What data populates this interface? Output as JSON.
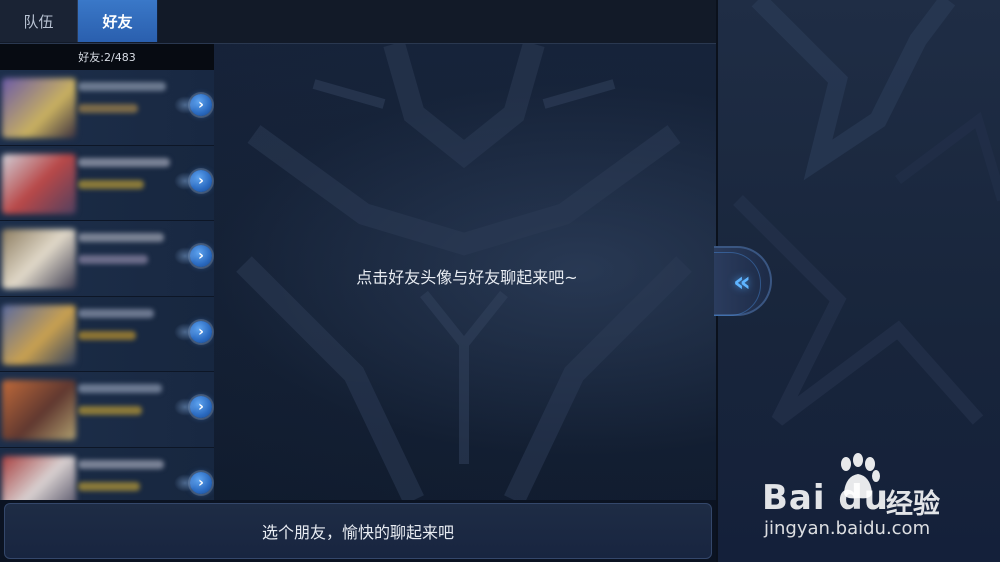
{
  "tabs": {
    "team_label": "队伍",
    "friends_label": "好友"
  },
  "friends_list": {
    "count_label": "好友:2/483",
    "rows": [
      {
        "avatar_color": "#6b5aa8",
        "chevron": "›"
      },
      {
        "avatar_color": "#b84848",
        "chevron": "›"
      },
      {
        "avatar_color": "#8c7c60",
        "chevron": "›"
      },
      {
        "avatar_color": "#5a6aa0",
        "chevron": "›"
      },
      {
        "avatar_color": "#c06a3a",
        "chevron": "›"
      },
      {
        "avatar_color": "#a84040",
        "chevron": "›"
      }
    ]
  },
  "chat": {
    "hint": "点击好友头像与好友聊起来吧~"
  },
  "input": {
    "placeholder": "选个朋友，愉快的聊起来吧"
  },
  "collapse_handle": {
    "glyph": "«"
  },
  "watermark": {
    "logo": "Bai du",
    "logo_cn": "经验",
    "url": "jingyan.baidu.com"
  },
  "colors": {
    "tab_active": "#3a78c8",
    "accent_blue": "#5fb4ff",
    "panel_bg": "#142238"
  }
}
